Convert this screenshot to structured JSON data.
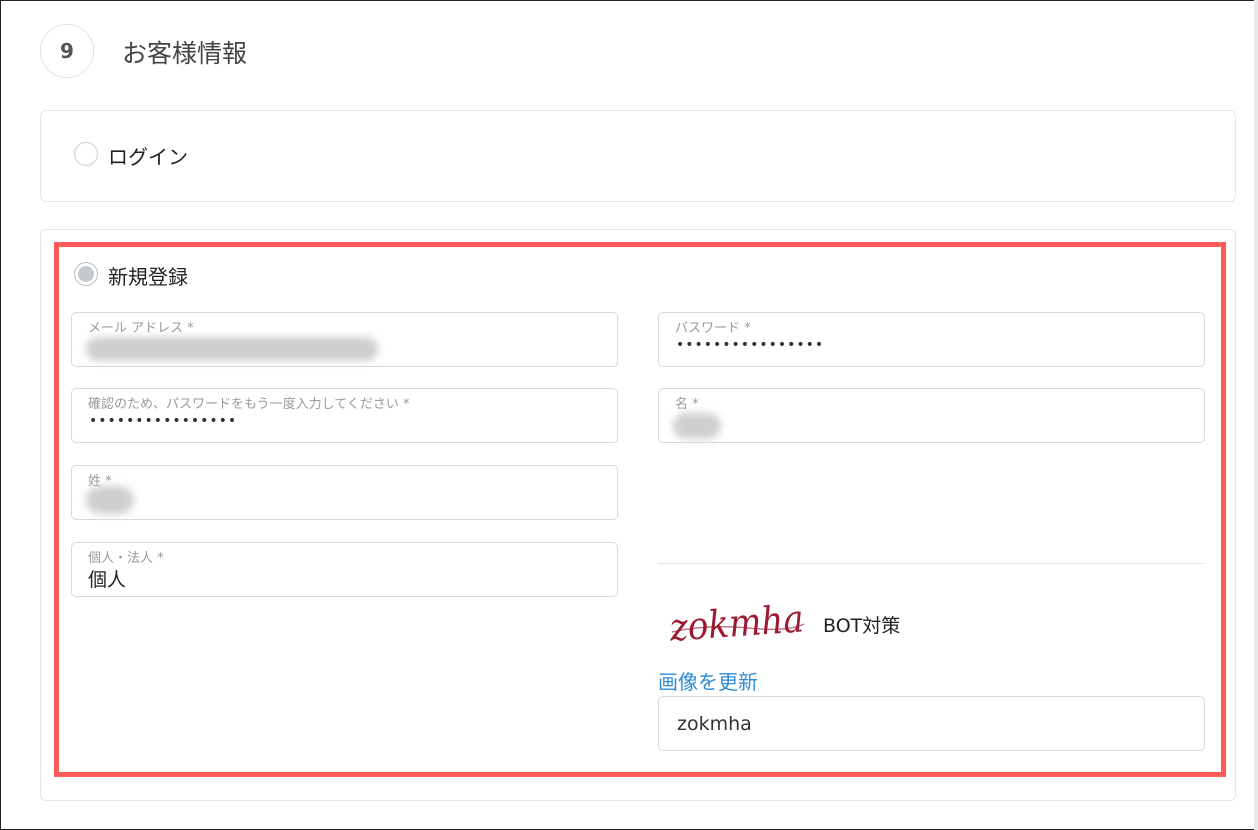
{
  "section": {
    "step_number": "9",
    "title": "お客様情報"
  },
  "login_option": {
    "label": "ログイン",
    "selected": false
  },
  "register_option": {
    "label": "新規登録",
    "selected": true
  },
  "form": {
    "email": {
      "label": "メール アドレス *"
    },
    "password": {
      "label": "パスワード *",
      "value": "••••••••••••••••"
    },
    "password_confirm": {
      "label": "確認のため、パスワードをもう一度入力してください *",
      "value": "••••••••••••••••"
    },
    "first_name": {
      "label": "名 *"
    },
    "last_name": {
      "label": "姓 *"
    },
    "entity_type": {
      "label": "個人・法人 *",
      "value": "個人"
    }
  },
  "captcha": {
    "image_text": "zokmha",
    "label": "BOT対策",
    "refresh_label": "画像を更新",
    "input_value": "zokmha"
  },
  "colors": {
    "highlight": "#ff5b5b",
    "link": "#2f8cd6",
    "captcha_text": "#9b1b30"
  }
}
